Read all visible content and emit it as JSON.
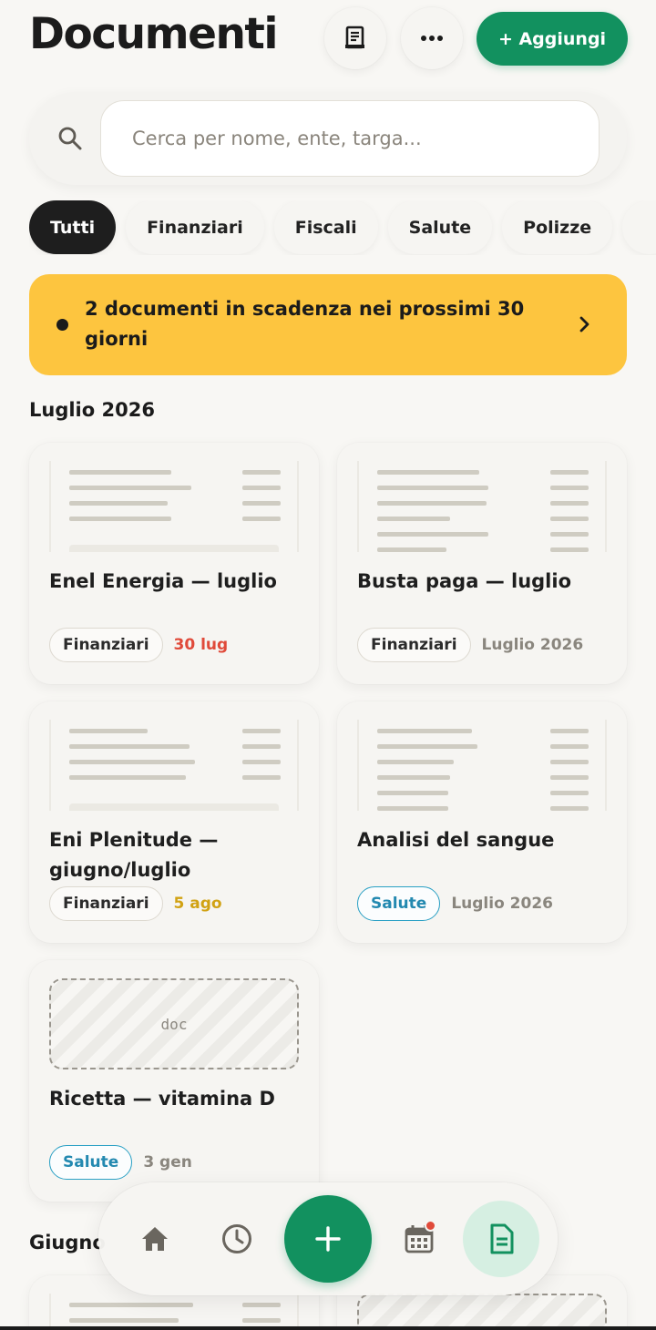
{
  "header": {
    "title": "Documenti",
    "add_label": "+ Aggiungi"
  },
  "search": {
    "placeholder": "Cerca per nome, ente, targa..."
  },
  "filters": [
    "Tutti",
    "Finanziari",
    "Fiscali",
    "Salute",
    "Polizze"
  ],
  "banner": {
    "text": "2 documenti in scadenza nei prossimi 30 giorni"
  },
  "sections": [
    {
      "title": "Luglio 2026",
      "cards": [
        {
          "title": "Enel Energia — luglio",
          "tag": "Finanziari",
          "date": "30 lug",
          "date_color": "#e04a3a"
        },
        {
          "title": "Busta paga — luglio",
          "tag": "Finanziari",
          "date": "Luglio 2026",
          "date_color": "#8a867e"
        },
        {
          "title": "Eni Plenitude — giugno/luglio",
          "tag": "Finanziari",
          "date": "5 ago",
          "date_color": "#d1a213"
        },
        {
          "title": "Analisi del sangue",
          "tag": "Salute",
          "date": "Luglio 2026",
          "date_color": "#8a867e"
        },
        {
          "title": "Ricetta — vitamina D",
          "tag": "Salute",
          "date": "3 gen",
          "date_color": "#8a867e",
          "thumb_text": "doc"
        }
      ]
    },
    {
      "title": "Giugno"
    }
  ],
  "colors": {
    "accent_green": "#12915f",
    "warning_yellow": "#fdc53f",
    "health_blue": "#2389b0",
    "danger_red": "#e04a3a"
  },
  "nav": {
    "items": [
      "home-icon",
      "history-icon",
      "add-icon",
      "calendar-icon",
      "document-icon"
    ],
    "active": "document-icon"
  }
}
